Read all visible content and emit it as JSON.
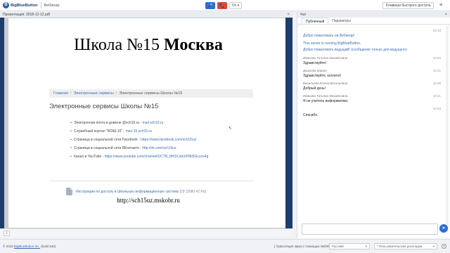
{
  "topbar": {
    "logo_mark": "B",
    "logo_text": "BigBlueButton",
    "meeting_name": "Вебинар",
    "mic_icon": "🎤",
    "phone_icon": "📞",
    "status_drop": "On ▾",
    "shortcuts_label": "Клавиши быстрого доступа",
    "menu_icon": "≡"
  },
  "presentation": {
    "header": "Презентация: 2018-12-12.pdf",
    "close": "×",
    "slide": {
      "title_regular": "Школа №15 ",
      "title_bold": "Москва",
      "breadcrumb": [
        "Главная",
        "Электронные сервисы",
        "Электронные сервисы Школы №15"
      ],
      "heading": "Электронные сервисы Школы №15",
      "items": [
        {
          "text": "Электронная почта в домене @sch15.ru - ",
          "link": "mail.sch15.ru"
        },
        {
          "text": "Служебный портал \"МЭШ-15\" - ",
          "link": "mes-15.sch15.ru"
        },
        {
          "text": "Страница в социальной сети Facebook - ",
          "link": "https://www.facebook.com/sch15uz/"
        },
        {
          "text": "Страница в социальной сети ВКонтакте - ",
          "link": "http://vk.com/sch15uz"
        },
        {
          "text": "Канал в YouTube - ",
          "link": "https://www.youtube.com/channel/UCTB_8H3XJehXP8b5Gccos4g"
        }
      ],
      "doc_link": "Инструкции по доступу в Школьную информационную систему 2.0",
      "doc_size": "[2080.42 Kb]",
      "url": "http://sch15uz.mskobr.ru"
    },
    "cursor": "↖",
    "upload_icon": "⇪"
  },
  "chat": {
    "header": "Чат",
    "close": "×",
    "tabs": [
      "Публичный",
      "Параметры"
    ],
    "messages": [
      {
        "author": "",
        "time": "09:18",
        "lines": [
          "Добро пожаловать на Вебинар!"
        ],
        "system": true
      },
      {
        "author": "",
        "time": "",
        "lines": [
          "This server is running BigBlueButton."
        ],
        "system": true
      },
      {
        "author": "",
        "time": "",
        "lines": [
          "Добро пожаловать ведущий! (сообщение только для ведущего)"
        ],
        "system": true
      },
      {
        "author": "Иванова Татьяна Михайловна",
        "time": "10:20",
        "lines": [
          "Здравствуйте!"
        ],
        "system": false
      },
      {
        "author": "Дашкова Мария",
        "time": "10:21",
        "lines": [
          "Здравствуйте, коллеги!"
        ],
        "system": false
      },
      {
        "author": "Васильева Елена Витальевна",
        "time": "10:36",
        "lines": [
          "Добрый день!"
        ],
        "system": false
      },
      {
        "author": "Иванова Татьяна Михайловна",
        "time": "10:41",
        "lines": [
          "Я не учитель информатики."
        ],
        "system": false
      },
      {
        "author": "",
        "time": "10:43",
        "lines": [
          "Спасибо."
        ],
        "system": false
      }
    ],
    "send_icon": "➤"
  },
  "bottombar": {
    "copyright_prefix": "© 2018 ",
    "copyright_link": "BigBlueButton Inc.",
    "copyright_suffix": " (build 840)",
    "webrtc": "[ Трансляция звука с помощью WebRTC ]",
    "language": "Русский",
    "layout": "* Пользовательская раскладка",
    "help_icon": "?"
  }
}
